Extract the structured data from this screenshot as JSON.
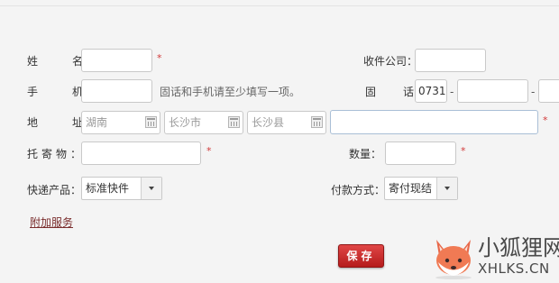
{
  "form": {
    "name_label": "姓　名：",
    "company_label": "收件公司：",
    "mobile_label": "手　机：",
    "mobile_hint": "固话和手机请至少填写一项。",
    "phone_label": "固　话：",
    "area_code": "0731",
    "dash": "-",
    "address_label": "地　址：",
    "province": "湖南",
    "city": "长沙市",
    "county": "长沙县",
    "goods_label": "托寄物：",
    "qty_label": "数量：",
    "express_label": "快递产品：",
    "express_value": "标准快件",
    "pay_label": "付款方式：",
    "pay_value": "寄付现结",
    "required_mark": "*"
  },
  "links": {
    "extra_service": "附加服务"
  },
  "buttons": {
    "save": "保存"
  },
  "watermark": {
    "line1": "小狐狸网",
    "line2": "XHLKS.CN"
  },
  "colors": {
    "required": "#d23a3a",
    "save_button": "#c92a2a",
    "link": "#7a2d2d"
  }
}
